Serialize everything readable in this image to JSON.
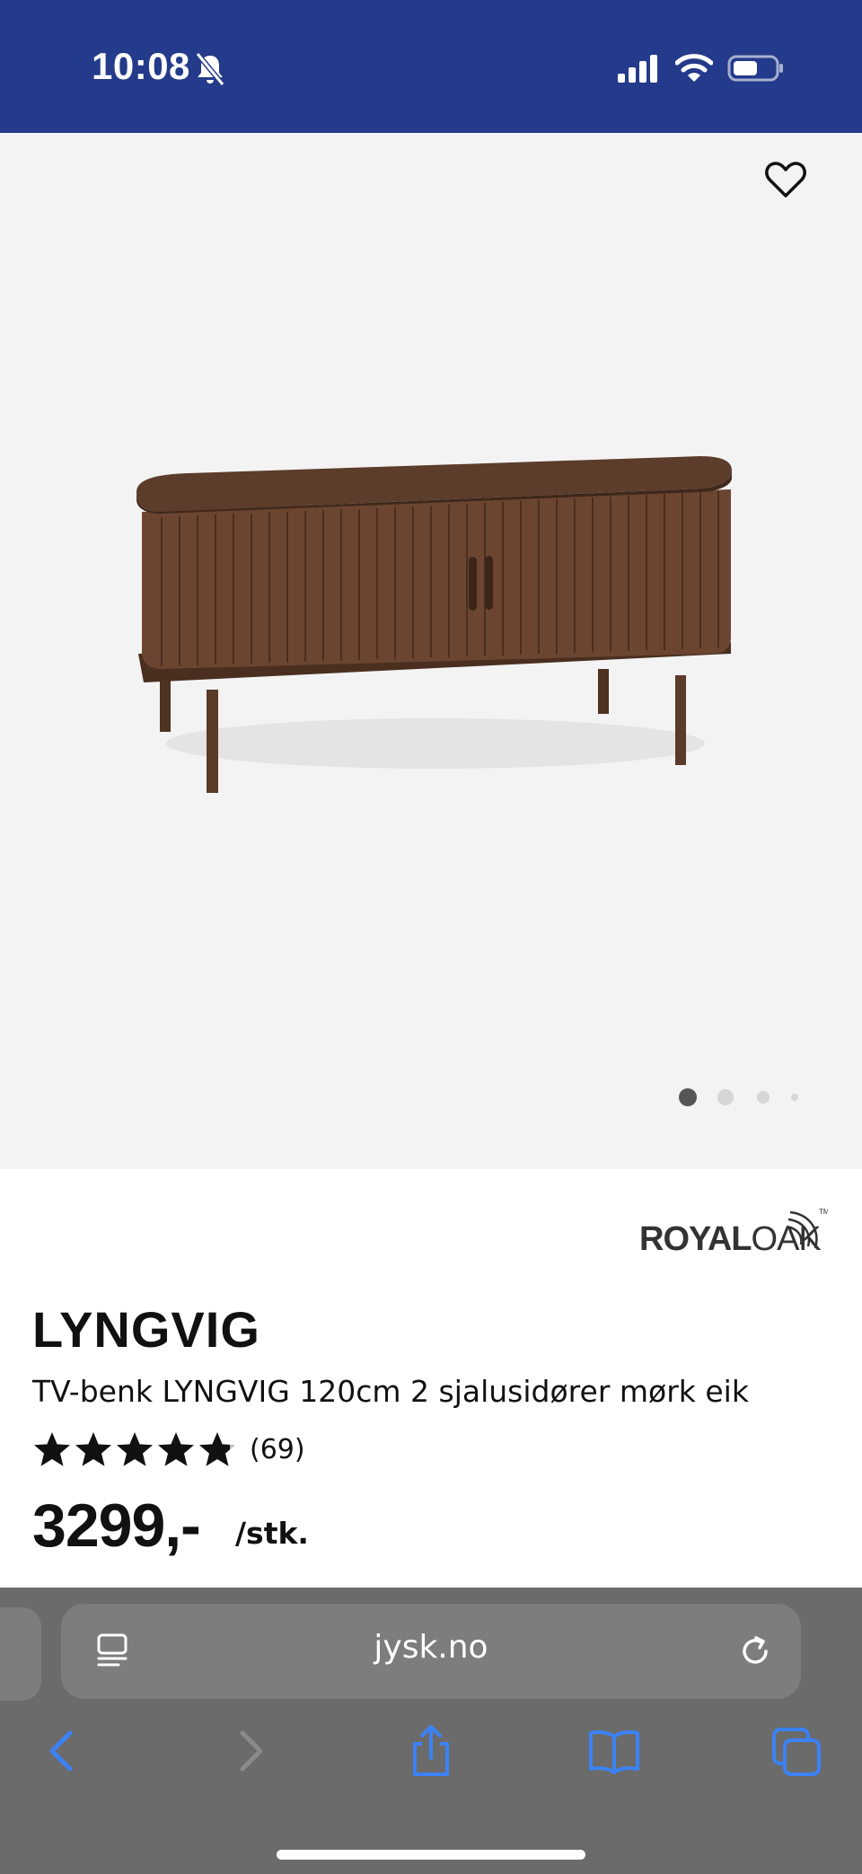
{
  "status_bar": {
    "time": "10:08",
    "background_color": "#243a8a"
  },
  "gallery": {
    "image_alt": "TV-benk LYNGVIG mørk eik",
    "total_images": 4,
    "active_image": 1
  },
  "product": {
    "brand": "ROYAL OAK",
    "name": "LYNGVIG",
    "description": "TV-benk LYNGVIG 120cm 2 sjalusidører mørk eik",
    "rating": 4.8,
    "review_count": "(69)",
    "price": "3299,-",
    "unit": "/stk."
  },
  "browser": {
    "url": "jysk.no",
    "accent_color": "#3b82f6"
  }
}
